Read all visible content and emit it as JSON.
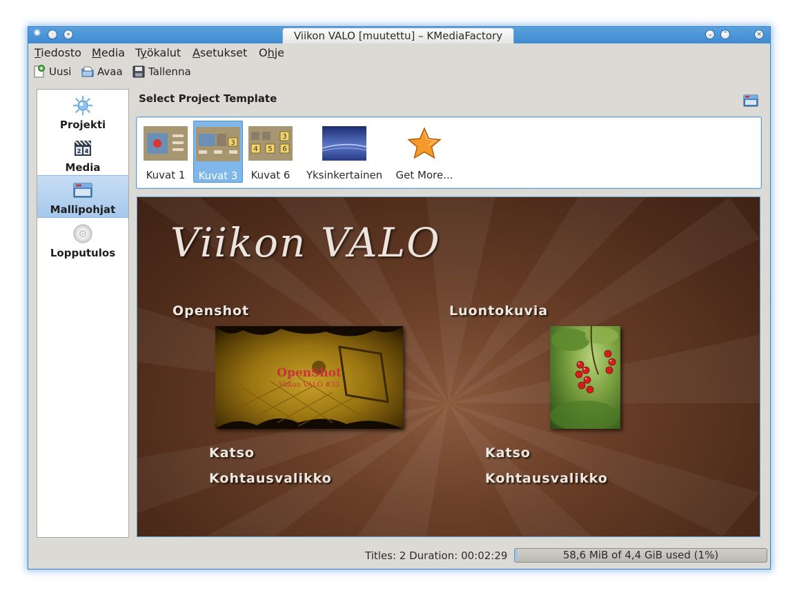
{
  "window": {
    "title": "Viikon VALO [muutettu] – KMediaFactory",
    "accent": "#4a97d8"
  },
  "menu": [
    {
      "label": "Tiedosto",
      "mnemonic": "T",
      "rest": "iedosto"
    },
    {
      "label": "Media",
      "mnemonic": "M",
      "rest": "edia"
    },
    {
      "label": "Työkalut",
      "mnemonic": "y",
      "pre": "T",
      "rest": "ökalut"
    },
    {
      "label": "Asetukset",
      "mnemonic": "A",
      "rest": "setukset"
    },
    {
      "label": "Ohje",
      "mnemonic": "h",
      "pre": "O",
      "rest": "je"
    }
  ],
  "toolbar": {
    "new_label": "Uusi",
    "open_label": "Avaa",
    "save_label": "Tallenna"
  },
  "sidebar": {
    "items": [
      {
        "label": "Projekti",
        "icon": "project-icon"
      },
      {
        "label": "Media",
        "icon": "media-icon"
      },
      {
        "label": "Mallipohjat",
        "icon": "templates-icon",
        "active": true
      },
      {
        "label": "Lopputulos",
        "icon": "output-disc-icon"
      }
    ]
  },
  "main": {
    "section_title": "Select Project Template",
    "templates": [
      {
        "name": "Kuvat 1"
      },
      {
        "name": "Kuvat 3",
        "selected": true
      },
      {
        "name": "Kuvat 6"
      },
      {
        "name": "Yksinkertainen"
      },
      {
        "name": "Get More..."
      }
    ]
  },
  "preview": {
    "title": "Viikon VALO",
    "items": [
      {
        "title": "Openshot",
        "image_text": "OpenShot",
        "image_subtext": "Viikon VALO #33",
        "play": "Katso",
        "chapters": "Kohtausvalikko"
      },
      {
        "title": "Luontokuvia",
        "play": "Katso",
        "chapters": "Kohtausvalikko"
      }
    ]
  },
  "statusbar": {
    "summary": "Titles: 2 Duration: 00:02:29",
    "disk_usage": "58,6 MiB of 4,4 GiB used (1%)",
    "disk_fraction": 0.01
  }
}
